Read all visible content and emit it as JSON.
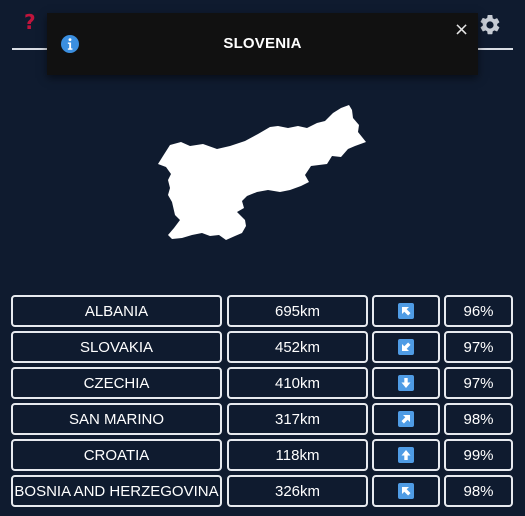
{
  "header": {
    "help_icon": "question-mark-icon",
    "help_glyph": "?",
    "help_color": "#c0143c",
    "settings_icon": "gear-icon"
  },
  "toast": {
    "icon": "info-icon",
    "title": "SLOVENIA",
    "close_glyph": "×"
  },
  "target_country": {
    "name": "Slovenia",
    "shape_color": "#ffffff"
  },
  "guesses": [
    {
      "country": "ALBANIA",
      "distance": "695km",
      "direction": "north-west",
      "proximity": "96%"
    },
    {
      "country": "SLOVAKIA",
      "distance": "452km",
      "direction": "south-west",
      "proximity": "97%"
    },
    {
      "country": "CZECHIA",
      "distance": "410km",
      "direction": "south",
      "proximity": "97%"
    },
    {
      "country": "SAN MARINO",
      "distance": "317km",
      "direction": "north-east",
      "proximity": "98%"
    },
    {
      "country": "CROATIA",
      "distance": "118km",
      "direction": "north",
      "proximity": "99%"
    },
    {
      "country": "BOSNIA AND HERZEGOVINA",
      "distance": "326km",
      "direction": "north-west",
      "proximity": "98%"
    }
  ],
  "colors": {
    "background": "#0f1b2f",
    "cell_border": "#e7eaef",
    "direction_box": "#4f9ce5",
    "toast_background": "#111111"
  }
}
